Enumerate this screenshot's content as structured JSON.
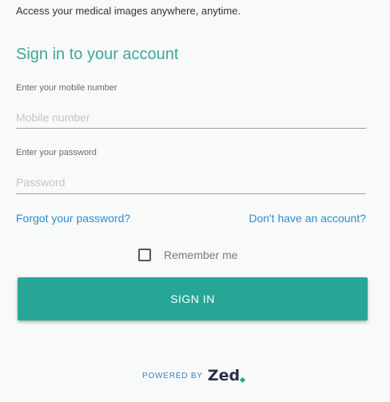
{
  "tagline": "Access your medical images anywhere, anytime.",
  "heading": "Sign in to your account",
  "mobile": {
    "label": "Enter your mobile number",
    "placeholder": "Mobile number",
    "value": ""
  },
  "password": {
    "label": "Enter your password",
    "placeholder": "Password",
    "value": ""
  },
  "links": {
    "forgot": "Forgot your password?",
    "signup": "Don't have an account?"
  },
  "remember": {
    "label": "Remember me",
    "checked": false
  },
  "signin_button": "SIGN IN",
  "footer": {
    "powered_by": "POWERED BY",
    "brand": "Zed"
  },
  "colors": {
    "accent": "#27a698",
    "heading": "#3fa79b",
    "link": "#2c8fcf",
    "brand_text": "#2a2f4a"
  },
  "icons": {
    "brand_mark": "teal-diamond-dot"
  }
}
